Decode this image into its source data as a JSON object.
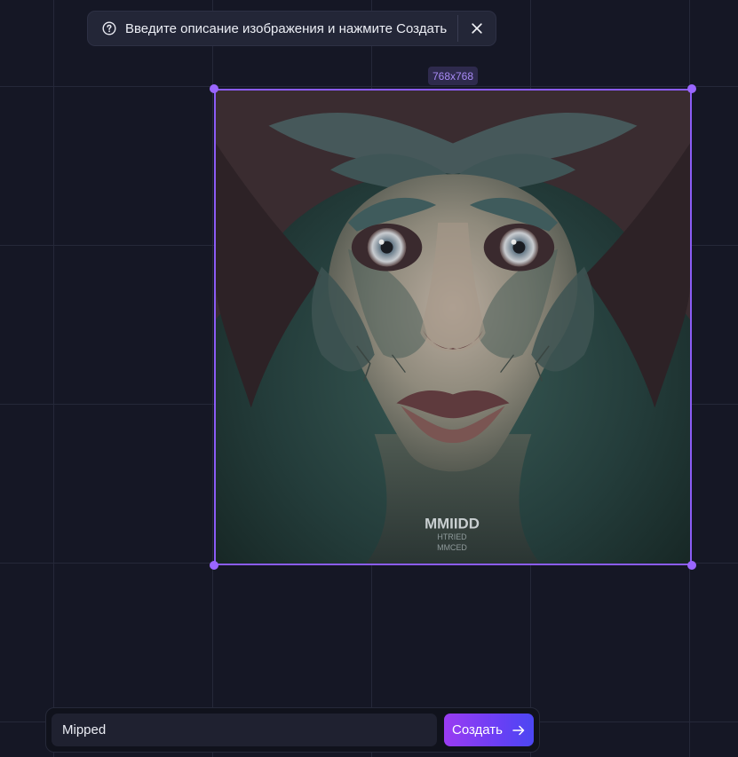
{
  "hint": {
    "text": "Введите описание изображения и нажмите Создать",
    "help_icon": "question-circle-icon",
    "close_icon": "close-icon"
  },
  "canvas": {
    "size_label": "768x768",
    "image": {
      "watermark_lines": [
        "MMIIDD",
        "HTRIED",
        "MMCED"
      ]
    },
    "accent_color": "#8b5cf6"
  },
  "prompt": {
    "value": "Mipped",
    "placeholder": "",
    "submit_label": "Создать",
    "submit_icon": "arrow-right-icon"
  },
  "colors": {
    "background": "#151725",
    "button_gradient_start": "#9a3cf2",
    "button_gradient_end": "#4c47f2"
  }
}
